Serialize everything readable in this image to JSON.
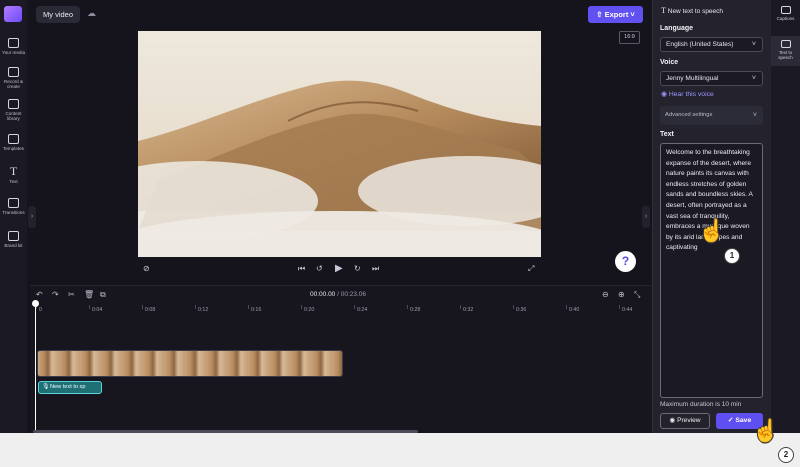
{
  "header": {
    "project_title": "My video",
    "export_label": "Export",
    "aspect_ratio": "16:9"
  },
  "left_rail": {
    "items": [
      {
        "label": "Your media"
      },
      {
        "label": "Record & create"
      },
      {
        "label": "Content library"
      },
      {
        "label": "Templates"
      },
      {
        "label": "Text"
      },
      {
        "label": "Transitions"
      },
      {
        "label": "Brand kit"
      }
    ]
  },
  "player": {
    "help": "?"
  },
  "timeline": {
    "current_time": "00:00.00",
    "total_time": "/ 00:23.06",
    "ruler": [
      "0",
      "0:04",
      "0:08",
      "0:12",
      "0:16",
      "0:20",
      "0:24",
      "0:28",
      "0:32",
      "0:36",
      "0:40",
      "0:44"
    ],
    "tts_clip_label": "New text to sp"
  },
  "panel": {
    "header": "New text to speech",
    "language_label": "Language",
    "language_value": "English (United States)",
    "voice_label": "Voice",
    "voice_value": "Jenny Multilingual",
    "hear_voice": "Hear this voice",
    "advanced_settings": "Advanced settings",
    "text_label": "Text",
    "text_value": "Welcome to the breathtaking expanse of the desert, where nature paints its canvas with endless stretches of golden sands and boundless skies. A desert, often portrayed as a vast sea of tranquility, embraces a mystique woven by its arid landscapes and captivating",
    "max_duration": "Maximum duration is 10 min",
    "preview_label": "Preview",
    "save_label": "Save"
  },
  "right_rail": {
    "items": [
      {
        "label": "Captions"
      },
      {
        "label": "Text to speech"
      }
    ]
  },
  "steps": [
    "1",
    "2"
  ]
}
